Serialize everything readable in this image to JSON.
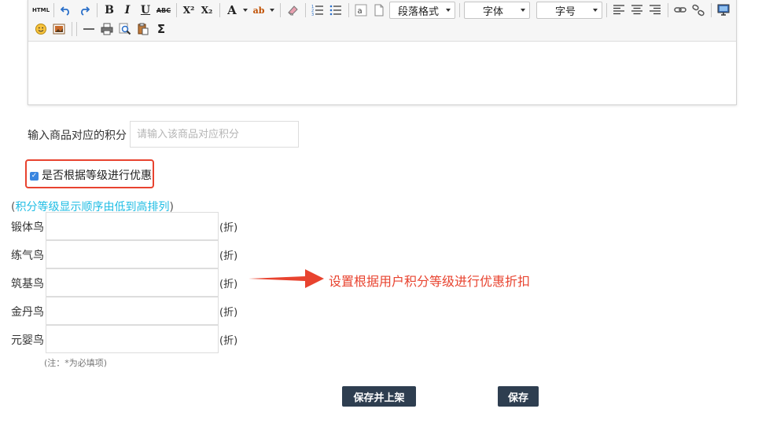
{
  "toolbar": {
    "html_label": "HTML",
    "bold": "B",
    "italic": "I",
    "underline": "U",
    "strike": "ABC",
    "superscript": "X²",
    "subscript": "X₂",
    "font_color": "A",
    "highlight": "ab",
    "paragraph_format": "段落格式",
    "font_family": "字体",
    "font_size": "字号",
    "sum": "Σ"
  },
  "points": {
    "label": "输入商品对应的积分",
    "placeholder": "请输入该商品对应积分",
    "value": ""
  },
  "discount_by_level": {
    "label": "是否根据等级进行优惠",
    "checked": true,
    "check_glyph": "✓"
  },
  "level_hint": {
    "open": "(",
    "text": "积分等级显示顺序由低到高排列",
    "close": ")"
  },
  "levels": [
    {
      "name": "锻体鸟",
      "value": "",
      "unit": "(折)"
    },
    {
      "name": "练气鸟",
      "value": "",
      "unit": "(折)"
    },
    {
      "name": "筑基鸟",
      "value": "",
      "unit": "(折)"
    },
    {
      "name": "金丹鸟",
      "value": "",
      "unit": "(折)"
    },
    {
      "name": "元婴鸟",
      "value": "",
      "unit": "(折)"
    }
  ],
  "note": "(注：*为必填项)",
  "annotation": "设置根据用户积分等级进行优惠折扣",
  "buttons": {
    "save_and_list": "保存并上架",
    "save": "保存"
  },
  "colors": {
    "accent_red": "#e8432f",
    "hint_cyan": "#1fbde4",
    "button_bg": "#2e3e50",
    "checkbox_blue": "#3a86e0"
  }
}
